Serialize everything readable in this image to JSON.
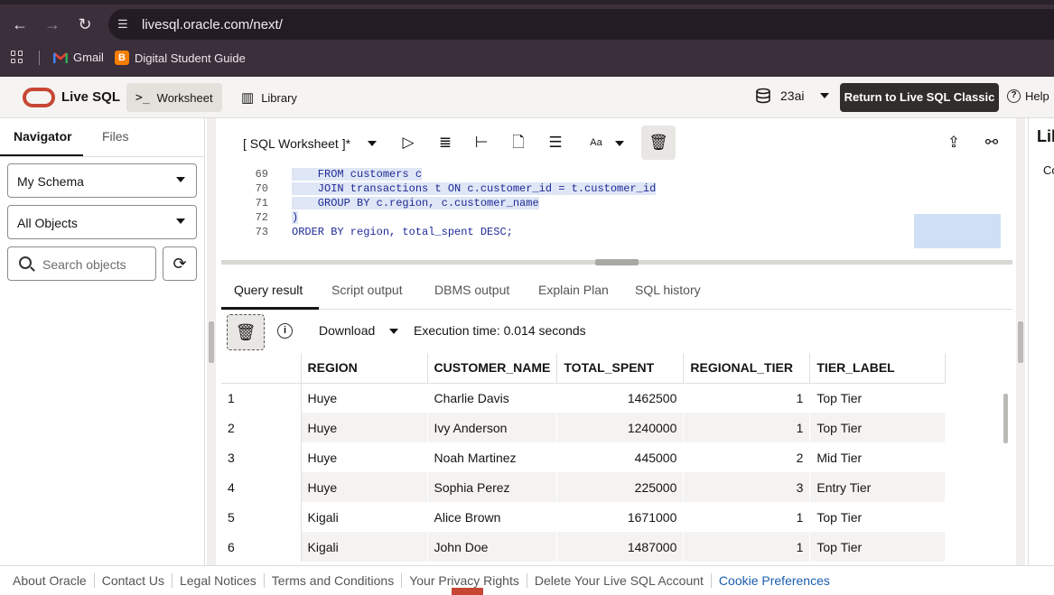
{
  "browser": {
    "url": "livesql.oracle.com/next/",
    "bookmarks": [
      {
        "label": "Gmail",
        "icon": "gmail-icon"
      },
      {
        "label": "Digital Student Guide",
        "icon": "blogger-icon"
      }
    ]
  },
  "app": {
    "title": "Live SQL",
    "tabs": {
      "worksheet": "Worksheet",
      "library": "Library"
    },
    "db_version": "23ai",
    "return_button": "Return to Live SQL Classic",
    "help": "Help"
  },
  "navigator": {
    "tabs": {
      "navigator": "Navigator",
      "files": "Files"
    },
    "schema_select": "My Schema",
    "objects_select": "All Objects",
    "search_placeholder": "Search objects"
  },
  "worksheet": {
    "title": "[ SQL Worksheet ]*",
    "lines": [
      {
        "num": "69",
        "code": "    FROM customers c"
      },
      {
        "num": "70",
        "code": "    JOIN transactions t ON c.customer_id = t.customer_id"
      },
      {
        "num": "71",
        "code": "    GROUP BY c.region, c.customer_name"
      },
      {
        "num": "72",
        "code": ")"
      },
      {
        "num": "73",
        "code": "ORDER BY region, total_spent DESC;"
      }
    ]
  },
  "results": {
    "tabs": [
      "Query result",
      "Script output",
      "DBMS output",
      "Explain Plan",
      "SQL history"
    ],
    "download_label": "Download",
    "execution_time": "Execution time: 0.014 seconds",
    "columns": [
      "REGION",
      "CUSTOMER_NAME",
      "TOTAL_SPENT",
      "REGIONAL_TIER",
      "TIER_LABEL"
    ],
    "rows": [
      [
        "1",
        "Huye",
        "Charlie Davis",
        "1462500",
        "1",
        "Top Tier"
      ],
      [
        "2",
        "Huye",
        "Ivy Anderson",
        "1240000",
        "1",
        "Top Tier"
      ],
      [
        "3",
        "Huye",
        "Noah Martinez",
        "445000",
        "2",
        "Mid Tier"
      ],
      [
        "4",
        "Huye",
        "Sophia Perez",
        "225000",
        "3",
        "Entry Tier"
      ],
      [
        "5",
        "Kigali",
        "Alice Brown",
        "1671000",
        "1",
        "Top Tier"
      ],
      [
        "6",
        "Kigali",
        "John Doe",
        "1487000",
        "1",
        "Top Tier"
      ]
    ]
  },
  "right_panel": {
    "title": "Lib",
    "tab": "Co"
  },
  "footer": {
    "links": [
      "About Oracle",
      "Contact Us",
      "Legal Notices",
      "Terms and Conditions",
      "Your Privacy Rights",
      "Delete Your Live SQL Account"
    ],
    "cookie": "Cookie Preferences"
  },
  "colors": {
    "oracle_red": "#c74634",
    "chrome_bg": "#3b2f3c",
    "dark_button": "#312d2a",
    "link_blue": "#1a5dad"
  }
}
